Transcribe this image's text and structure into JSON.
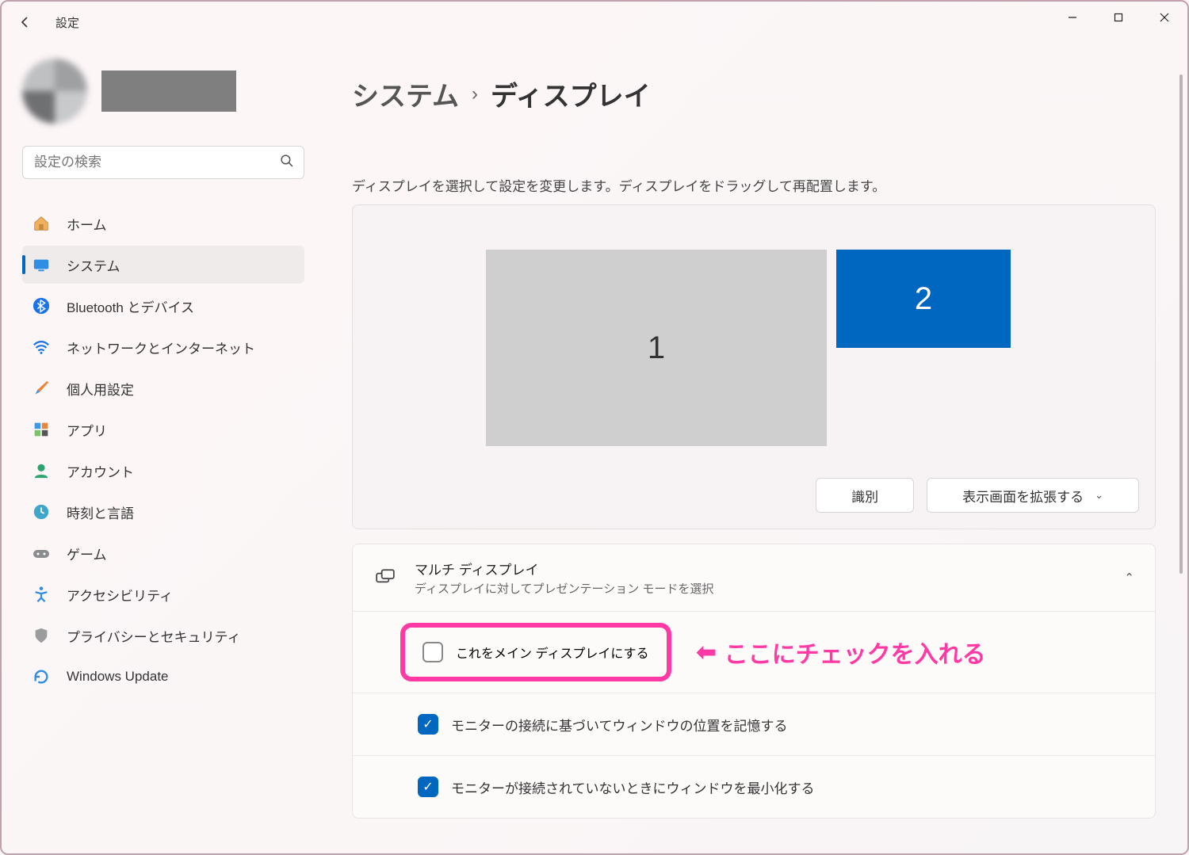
{
  "app_title": "設定",
  "search": {
    "placeholder": "設定の検索"
  },
  "nav": {
    "home": "ホーム",
    "system": "システム",
    "bluetooth": "Bluetooth とデバイス",
    "network": "ネットワークとインターネット",
    "personal": "個人用設定",
    "apps": "アプリ",
    "account": "アカウント",
    "time": "時刻と言語",
    "game": "ゲーム",
    "accessibility": "アクセシビリティ",
    "privacy": "プライバシーとセキュリティ",
    "update": "Windows Update"
  },
  "breadcrumb": {
    "parent": "システム",
    "child": "ディスプレイ"
  },
  "description": "ディスプレイを選択して設定を変更します。ディスプレイをドラッグして再配置します。",
  "monitors": {
    "m1": "1",
    "m2": "2"
  },
  "buttons": {
    "identify": "識別",
    "extend": "表示画面を拡張する"
  },
  "multi": {
    "title": "マルチ ディスプレイ",
    "subtitle": "ディスプレイに対してプレゼンテーション モードを選択",
    "make_main": "これをメイン ディスプレイにする",
    "remember": "モニターの接続に基づいてウィンドウの位置を記憶する",
    "minimize": "モニターが接続されていないときにウィンドウを最小化する"
  },
  "annotation": "ここにチェックを入れる"
}
